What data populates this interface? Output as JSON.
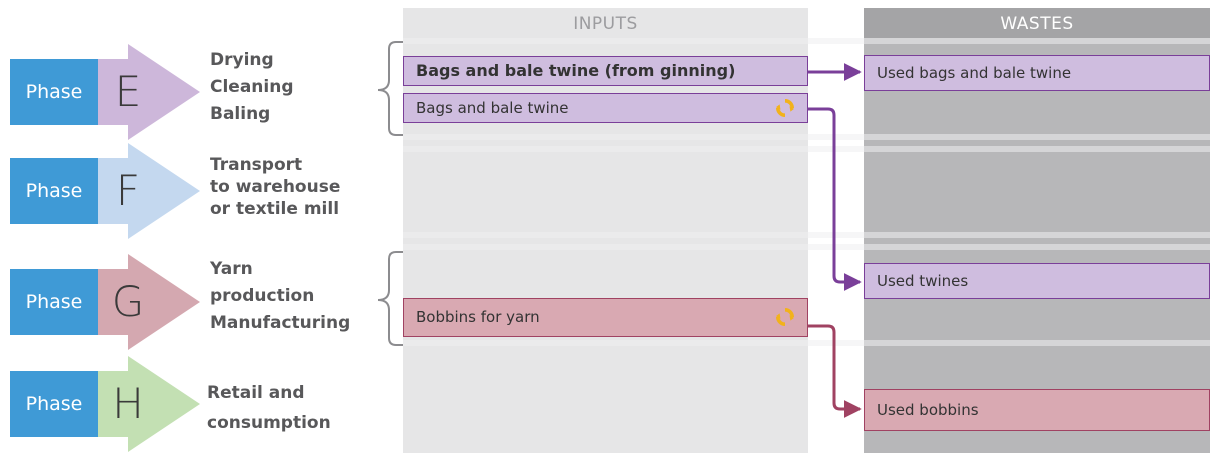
{
  "columns": {
    "inputs": "INPUTS",
    "wastes": "WASTES"
  },
  "phases": [
    {
      "word": "Phase",
      "letter": "E",
      "color": "#cdb7da",
      "lines": [
        "Drying",
        "Cleaning",
        "Baling"
      ]
    },
    {
      "word": "Phase",
      "letter": "F",
      "color": "#c4d8ef",
      "lines": [
        "Transport",
        "to warehouse",
        "or textile mill"
      ]
    },
    {
      "word": "Phase",
      "letter": "G",
      "color": "#d4a8b0",
      "lines": [
        "Yarn",
        "production",
        "Manufacturing"
      ]
    },
    {
      "word": "Phase",
      "letter": "H",
      "color": "#c3e0b3",
      "lines": [
        "Retail and",
        "consumption"
      ]
    }
  ],
  "inputs": [
    {
      "label": "Bags and bale twine (from ginning)",
      "recyclable": false
    },
    {
      "label": "Bags and bale twine",
      "recyclable": true,
      "icon": "recycle-icon"
    },
    {
      "label": "Bobbins for yarn",
      "recyclable": true,
      "icon": "recycle-icon"
    }
  ],
  "wastes": [
    {
      "label": "Used bags and bale twine"
    },
    {
      "label": "Used twines"
    },
    {
      "label": "Used bobbins"
    }
  ],
  "colors": {
    "phase_blue": "#3f9ad6",
    "purple_fill": "#cfbddf",
    "purple_line": "#7a3f99",
    "pink_fill": "#d9a9b2",
    "pink_line": "#a04262",
    "recycle": "#f2b21b"
  }
}
